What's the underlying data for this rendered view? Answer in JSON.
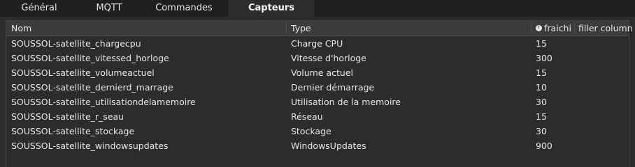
{
  "tabs": [
    {
      "label": "Général",
      "active": false
    },
    {
      "label": "MQTT",
      "active": false
    },
    {
      "label": "Commandes",
      "active": false
    },
    {
      "label": "Capteurs",
      "active": true
    }
  ],
  "table": {
    "columns": {
      "name": "Nom",
      "type": "Type",
      "refresh": "fraichi",
      "filler": "filler column"
    },
    "rows": [
      {
        "name": "SOUSSOL-satellite_chargecpu",
        "type": "Charge CPU",
        "refresh": "15"
      },
      {
        "name": "SOUSSOL-satellite_vitessed_horloge",
        "type": "Vitesse d'horloge",
        "refresh": "300"
      },
      {
        "name": "SOUSSOL-satellite_volumeactuel",
        "type": "Volume actuel",
        "refresh": "15"
      },
      {
        "name": "SOUSSOL-satellite_dernierd_marrage",
        "type": "Dernier démarrage",
        "refresh": "10"
      },
      {
        "name": "SOUSSOL-satellite_utilisationdelamemoire",
        "type": "Utilisation de la memoire",
        "refresh": "30"
      },
      {
        "name": "SOUSSOL-satellite_r_seau",
        "type": "Réseau",
        "refresh": "15"
      },
      {
        "name": "SOUSSOL-satellite_stockage",
        "type": "Stockage",
        "refresh": "30"
      },
      {
        "name": "SOUSSOL-satellite_windowsupdates",
        "type": "WindowsUpdates",
        "refresh": "900"
      }
    ]
  },
  "icons": {
    "refresh_header_icon": "timer-icon"
  },
  "colors": {
    "background": "#2b2c2e",
    "tabbar": "#1f1f20",
    "header": "#3a3b3d",
    "text": "#e6e6e6"
  }
}
